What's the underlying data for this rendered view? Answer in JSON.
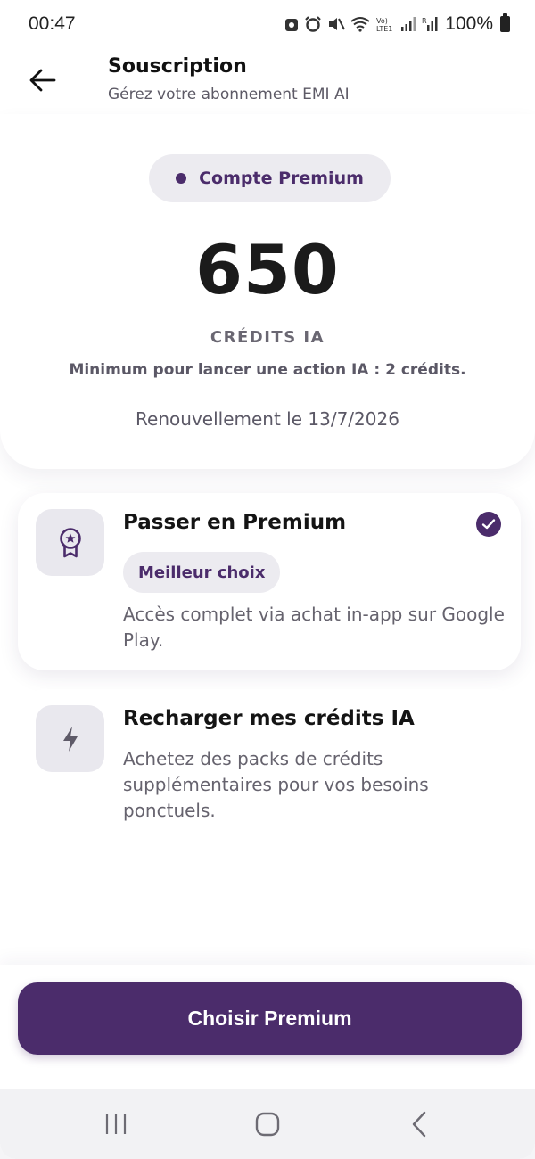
{
  "status_bar": {
    "time": "00:47",
    "battery": "100%"
  },
  "header": {
    "title": "Souscription",
    "subtitle": "Gérez votre abonnement EMI AI"
  },
  "summary": {
    "plan_badge": "Compte Premium",
    "credits_value": "650",
    "credits_label": "CRÉDITS IA",
    "minimum_note": "Minimum pour lancer une action IA : 2 crédits.",
    "renewal": "Renouvellement le 13/7/2026"
  },
  "options": [
    {
      "title": "Passer en Premium",
      "tag": "Meilleur choix",
      "description": "Accès complet via achat in-app sur Google Play.",
      "icon": "award-icon",
      "selected": true
    },
    {
      "title": "Recharger mes crédits IA",
      "description": "Achetez des packs de crédits supplémentaires pour vos besoins ponctuels.",
      "icon": "lightning-icon",
      "selected": false
    }
  ],
  "cta": {
    "label": "Choisir Premium"
  },
  "colors": {
    "accent": "#4b2c6b",
    "chip_background": "#ecebf0",
    "icon_box_background": "#e9e8ee"
  },
  "icons": {
    "back": "arrow-left-icon",
    "nav_recents": "recents-icon",
    "nav_home": "home-icon",
    "nav_back": "chevron-left-icon"
  }
}
